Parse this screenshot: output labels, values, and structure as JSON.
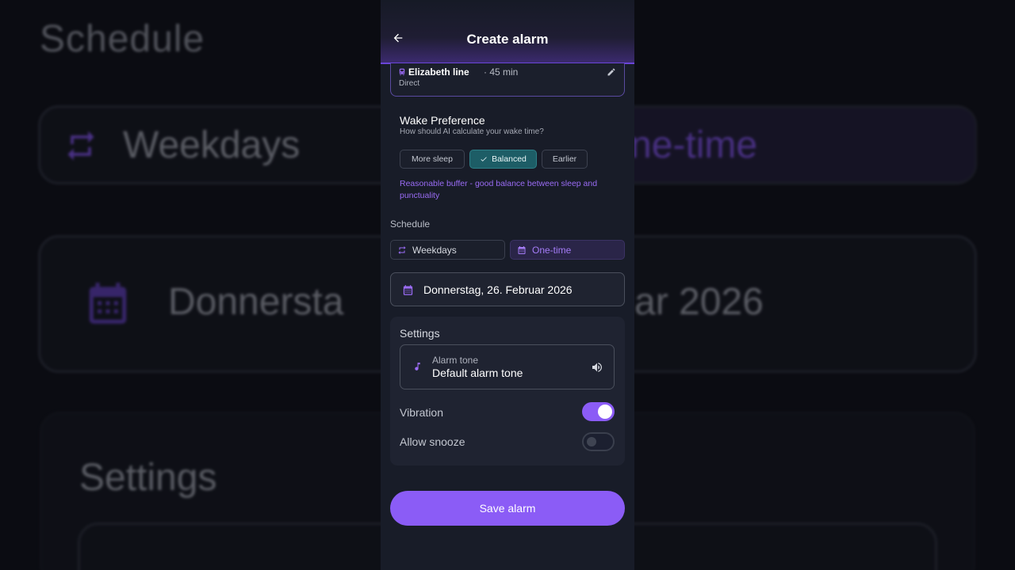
{
  "background": {
    "title": "Schedule",
    "weekdays": "Weekdays",
    "one_time_fragment": "ne-time",
    "date_left": "Donnersta",
    "date_right": "ar 2026",
    "settings": "Settings"
  },
  "header": {
    "title": "Create alarm",
    "back_icon": "arrow-left-icon"
  },
  "route": {
    "line_name": "Elizabeth line",
    "duration": "· 45 min",
    "type": "Direct",
    "edit_icon": "pencil-icon"
  },
  "wake_preference": {
    "title": "Wake Preference",
    "subtitle": "How should AI calculate your wake time?",
    "options": [
      "More sleep",
      "Balanced",
      "Earlier"
    ],
    "selected": "Balanced",
    "description": "Reasonable buffer - good balance between sleep and punctuality"
  },
  "schedule": {
    "label": "Schedule",
    "options": [
      "Weekdays",
      "One-time"
    ],
    "selected": "One-time",
    "date": "Donnerstag, 26. Februar 2026"
  },
  "settings": {
    "title": "Settings",
    "alarm_tone_label": "Alarm tone",
    "alarm_tone_value": "Default alarm tone",
    "vibration_label": "Vibration",
    "vibration_on": true,
    "snooze_label": "Allow snooze",
    "snooze_on": false
  },
  "actions": {
    "save_label": "Save alarm"
  },
  "colors": {
    "accent": "#8b5cf6",
    "selected_chip": "#1d5d66",
    "panel": "#1f2331",
    "background": "#181c28"
  }
}
